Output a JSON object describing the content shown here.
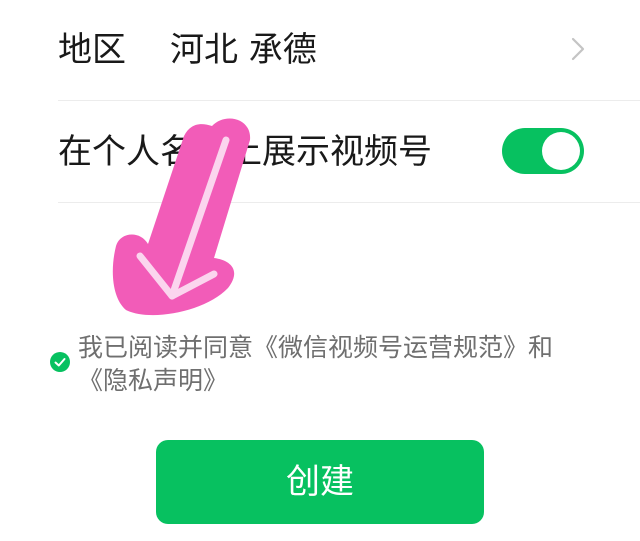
{
  "region": {
    "label": "地区",
    "value": "河北 承德"
  },
  "profile_toggle": {
    "label": "在个人名片上展示视频号",
    "enabled": true
  },
  "agreement": {
    "checked": true,
    "text": "我已阅读并同意《微信视频号运营规范》和《隐私声明》"
  },
  "create_button": {
    "label": "创建"
  },
  "colors": {
    "accent": "#07c160",
    "annotation_arrow": "#f25cb8"
  },
  "icons": {
    "region_chevron": "chevron-right-icon",
    "agreement_check": "checkmark-icon",
    "annotation": "arrow-down-left-icon"
  }
}
